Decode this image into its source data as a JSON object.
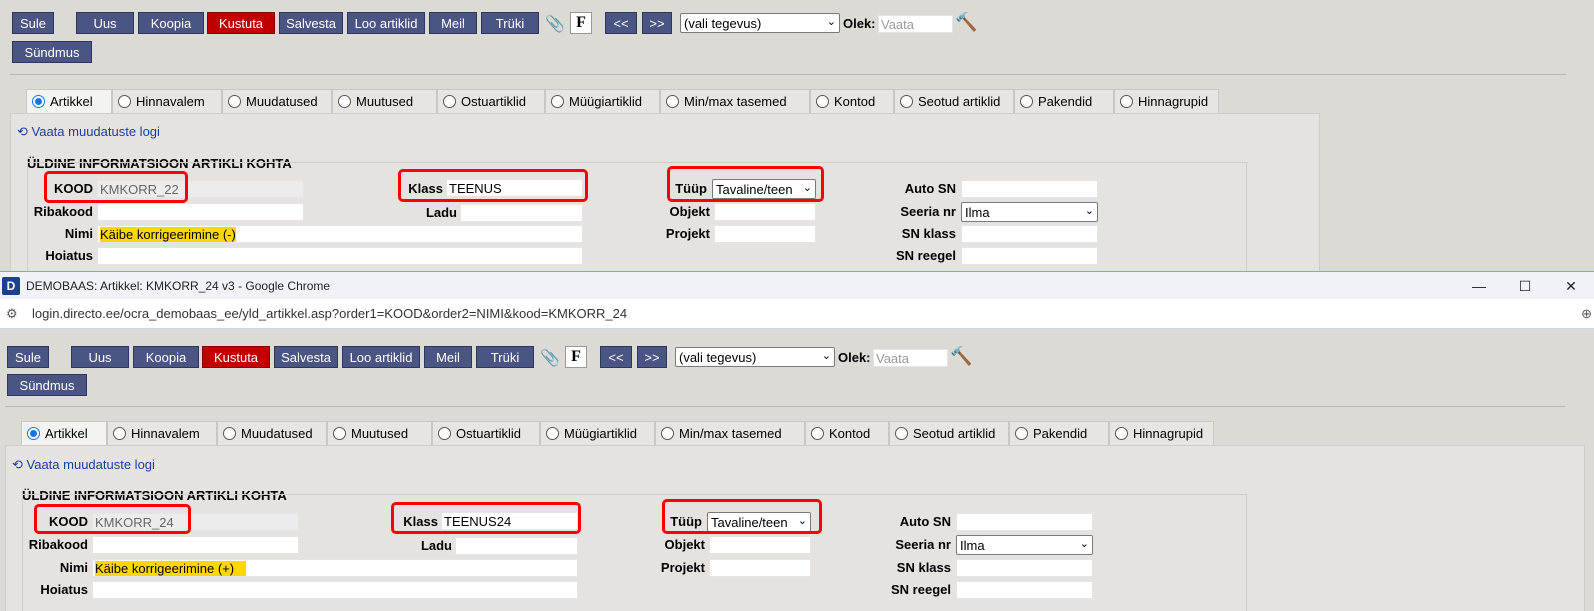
{
  "top": {
    "toolbar": {
      "close": "Sule",
      "new": "Uus",
      "copy": "Koopia",
      "delete": "Kustuta",
      "save": "Salvesta",
      "create_article": "Loo artiklid",
      "mail": "Meil",
      "print": "Trüki",
      "attach_icon": "paperclip-icon",
      "f_label": "F",
      "prev": "<<",
      "next": ">>",
      "action_select": "(vali tegevus)",
      "status_label": "Olek:",
      "status_placeholder": "Vaata",
      "event": "Sündmus"
    },
    "tabs": [
      "Artikkel",
      "Hinnavalem",
      "Muudatused",
      "Muutused",
      "Ostuartiklid",
      "Müügiartiklid",
      "Min/max tasemed",
      "Kontod",
      "Seotud artiklid",
      "Pakendid",
      "Hinnagrupid"
    ],
    "log_link": "Vaata muudatuste logi",
    "section_title": "ÜLDINE INFORMATSIOON ARTIKLI KOHTA",
    "fields": {
      "kood_label": "KOOD",
      "kood_value": "KMKORR_22",
      "klass_label": "Klass",
      "klass_value": "TEENUS",
      "tuup_label": "Tüüp",
      "tuup_value": "Tavaline/teen",
      "autosn_label": "Auto SN",
      "ribakood_label": "Ribakood",
      "ladu_label": "Ladu",
      "objekt_label": "Objekt",
      "seeria_label": "Seeria nr",
      "seeria_value": "Ilma",
      "nimi_label": "Nimi",
      "nimi_value": "Käibe korrigeerimine (-)",
      "projekt_label": "Projekt",
      "snklass_label": "SN klass",
      "hoiatus_label": "Hoiatus",
      "snreegel_label": "SN reegel"
    }
  },
  "chrome": {
    "window_title": "DEMOBAAS: Artikkel: KMKORR_24 v3 - Google Chrome",
    "logo": "D",
    "url": "login.directo.ee/ocra_demobaas_ee/yld_artikkel.asp?order1=KOOD&order2=NIMI&kood=KMKORR_24",
    "minimize": "—",
    "maximize": "☐",
    "close": "✕"
  },
  "bottom": {
    "toolbar": {
      "close": "Sule",
      "new": "Uus",
      "copy": "Koopia",
      "delete": "Kustuta",
      "save": "Salvesta",
      "create_article": "Loo artiklid",
      "mail": "Meil",
      "print": "Trüki",
      "attach_icon": "paperclip-icon",
      "f_label": "F",
      "prev": "<<",
      "next": ">>",
      "action_select": "(vali tegevus)",
      "status_label": "Olek:",
      "status_placeholder": "Vaata",
      "event": "Sündmus"
    },
    "tabs": [
      "Artikkel",
      "Hinnavalem",
      "Muudatused",
      "Muutused",
      "Ostuartiklid",
      "Müügiartiklid",
      "Min/max tasemed",
      "Kontod",
      "Seotud artiklid",
      "Pakendid",
      "Hinnagrupid"
    ],
    "log_link": "Vaata muudatuste logi",
    "section_title": "ÜLDINE INFORMATSIOON ARTIKLI KOHTA",
    "fields": {
      "kood_label": "KOOD",
      "kood_value": "KMKORR_24",
      "klass_label": "Klass",
      "klass_value": "TEENUS24",
      "tuup_label": "Tüüp",
      "tuup_value": "Tavaline/teen",
      "autosn_label": "Auto SN",
      "ribakood_label": "Ribakood",
      "ladu_label": "Ladu",
      "objekt_label": "Objekt",
      "seeria_label": "Seeria nr",
      "seeria_value": "Ilma",
      "nimi_label": "Nimi",
      "nimi_value": "Käibe korrigeerimine (+)",
      "projekt_label": "Projekt",
      "snklass_label": "SN klass",
      "hoiatus_label": "Hoiatus",
      "snreegel_label": "SN reegel"
    }
  },
  "colors": {
    "toolbar_button": "#4a5584",
    "delete_button": "#c00000",
    "highlight": "#ffd700",
    "annotation_box": "#ff0000"
  }
}
